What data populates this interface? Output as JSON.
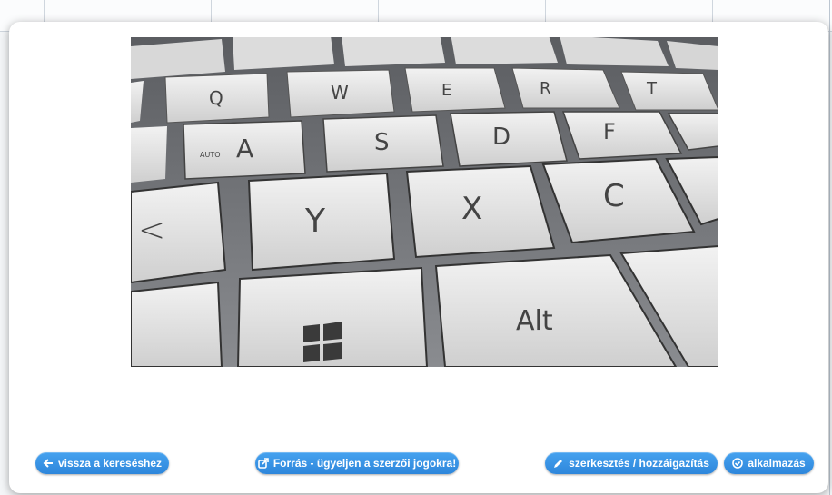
{
  "modal": {
    "image_alt": "keyboard close-up photo",
    "keys": {
      "q": "Q",
      "w": "W",
      "e": "E",
      "r": "R",
      "t": "T",
      "a": "A",
      "a_sub": "AUTO",
      "s": "S",
      "d": "D",
      "f": "F",
      "y": "Y",
      "x": "X",
      "c": "C",
      "lt": "<",
      "alt": "Alt"
    }
  },
  "buttons": {
    "back": {
      "label": "vissza a kereséshez",
      "icon": "arrow-left-icon"
    },
    "source": {
      "label": "Forrás - ügyeljen a szerzői jogokra!",
      "icon": "external-link-icon"
    },
    "edit": {
      "label": "szerkesztés / hozzáigazítás",
      "icon": "pencil-icon"
    },
    "apply": {
      "label": "alkalmazás",
      "icon": "check-circle-icon"
    }
  },
  "colors": {
    "button": "#2e86db",
    "button_text": "#ffffff",
    "modal_bg": "#ffffff",
    "backdrop": "#e9ecef"
  }
}
